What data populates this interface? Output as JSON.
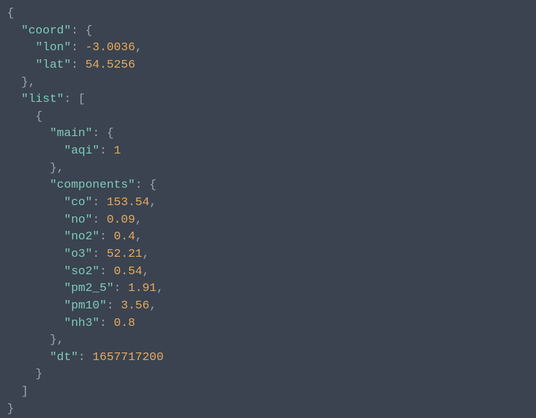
{
  "lines": [
    [
      {
        "cls": "punct",
        "t": "{"
      }
    ],
    [
      {
        "cls": "punct",
        "t": "  "
      },
      {
        "cls": "key",
        "t": "\"coord\""
      },
      {
        "cls": "punct",
        "t": ": {"
      }
    ],
    [
      {
        "cls": "punct",
        "t": "    "
      },
      {
        "cls": "key",
        "t": "\"lon\""
      },
      {
        "cls": "punct",
        "t": ": "
      },
      {
        "cls": "num",
        "t": "-3.0036"
      },
      {
        "cls": "punct",
        "t": ","
      }
    ],
    [
      {
        "cls": "punct",
        "t": "    "
      },
      {
        "cls": "key",
        "t": "\"lat\""
      },
      {
        "cls": "punct",
        "t": ": "
      },
      {
        "cls": "num",
        "t": "54.5256"
      }
    ],
    [
      {
        "cls": "punct",
        "t": "  },"
      }
    ],
    [
      {
        "cls": "punct",
        "t": "  "
      },
      {
        "cls": "key",
        "t": "\"list\""
      },
      {
        "cls": "punct",
        "t": ": ["
      }
    ],
    [
      {
        "cls": "punct",
        "t": "    {"
      }
    ],
    [
      {
        "cls": "punct",
        "t": "      "
      },
      {
        "cls": "key",
        "t": "\"main\""
      },
      {
        "cls": "punct",
        "t": ": {"
      }
    ],
    [
      {
        "cls": "punct",
        "t": "        "
      },
      {
        "cls": "key",
        "t": "\"aqi\""
      },
      {
        "cls": "punct",
        "t": ": "
      },
      {
        "cls": "num",
        "t": "1"
      }
    ],
    [
      {
        "cls": "punct",
        "t": "      },"
      }
    ],
    [
      {
        "cls": "punct",
        "t": "      "
      },
      {
        "cls": "key",
        "t": "\"components\""
      },
      {
        "cls": "punct",
        "t": ": {"
      }
    ],
    [
      {
        "cls": "punct",
        "t": "        "
      },
      {
        "cls": "key",
        "t": "\"co\""
      },
      {
        "cls": "punct",
        "t": ": "
      },
      {
        "cls": "num",
        "t": "153.54"
      },
      {
        "cls": "punct",
        "t": ","
      }
    ],
    [
      {
        "cls": "punct",
        "t": "        "
      },
      {
        "cls": "key",
        "t": "\"no\""
      },
      {
        "cls": "punct",
        "t": ": "
      },
      {
        "cls": "num",
        "t": "0.09"
      },
      {
        "cls": "punct",
        "t": ","
      }
    ],
    [
      {
        "cls": "punct",
        "t": "        "
      },
      {
        "cls": "key",
        "t": "\"no2\""
      },
      {
        "cls": "punct",
        "t": ": "
      },
      {
        "cls": "num",
        "t": "0.4"
      },
      {
        "cls": "punct",
        "t": ","
      }
    ],
    [
      {
        "cls": "punct",
        "t": "        "
      },
      {
        "cls": "key",
        "t": "\"o3\""
      },
      {
        "cls": "punct",
        "t": ": "
      },
      {
        "cls": "num",
        "t": "52.21"
      },
      {
        "cls": "punct",
        "t": ","
      }
    ],
    [
      {
        "cls": "punct",
        "t": "        "
      },
      {
        "cls": "key",
        "t": "\"so2\""
      },
      {
        "cls": "punct",
        "t": ": "
      },
      {
        "cls": "num",
        "t": "0.54"
      },
      {
        "cls": "punct",
        "t": ","
      }
    ],
    [
      {
        "cls": "punct",
        "t": "        "
      },
      {
        "cls": "key",
        "t": "\"pm2_5\""
      },
      {
        "cls": "punct",
        "t": ": "
      },
      {
        "cls": "num",
        "t": "1.91"
      },
      {
        "cls": "punct",
        "t": ","
      }
    ],
    [
      {
        "cls": "punct",
        "t": "        "
      },
      {
        "cls": "key",
        "t": "\"pm10\""
      },
      {
        "cls": "punct",
        "t": ": "
      },
      {
        "cls": "num",
        "t": "3.56"
      },
      {
        "cls": "punct",
        "t": ","
      }
    ],
    [
      {
        "cls": "punct",
        "t": "        "
      },
      {
        "cls": "key",
        "t": "\"nh3\""
      },
      {
        "cls": "punct",
        "t": ": "
      },
      {
        "cls": "num",
        "t": "0.8"
      }
    ],
    [
      {
        "cls": "punct",
        "t": "      },"
      }
    ],
    [
      {
        "cls": "punct",
        "t": "      "
      },
      {
        "cls": "key",
        "t": "\"dt\""
      },
      {
        "cls": "punct",
        "t": ": "
      },
      {
        "cls": "num",
        "t": "1657717200"
      }
    ],
    [
      {
        "cls": "punct",
        "t": "    }"
      }
    ],
    [
      {
        "cls": "punct",
        "t": "  ]"
      }
    ],
    [
      {
        "cls": "punct",
        "t": "}"
      }
    ]
  ]
}
